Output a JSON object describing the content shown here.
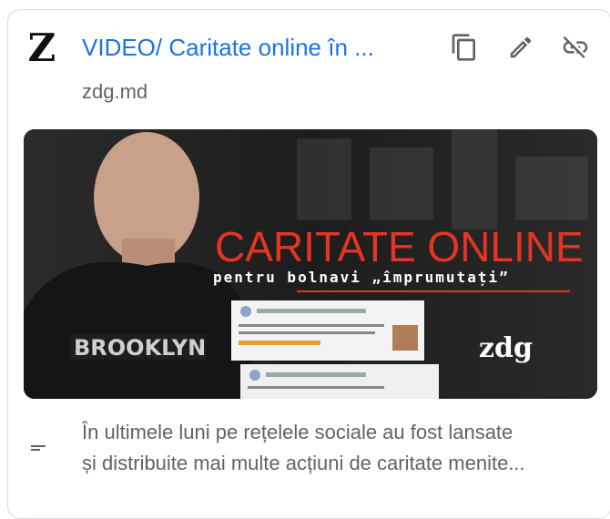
{
  "link_card": {
    "favicon_letter": "Z",
    "title": "VIDEO/ Caritate online în ...",
    "domain": "zdg.md",
    "description_lines": [
      "În ultimele luni pe rețelele sociale au fost lansate",
      "și distribuite mai multe acțiuni de caritate menite..."
    ],
    "actions": [
      "copy-icon",
      "edit-icon",
      "unlink-icon"
    ]
  },
  "thumbnail": {
    "headline": "CARITATE ONLINE",
    "subheadline": "pentru bolnavi „împrumutați”",
    "brand": "zdg",
    "hoodie_text": "BROOKLYN",
    "headline_color": "#e53422"
  },
  "colors": {
    "title": "#1a73e8",
    "secondary_text": "#5f6368",
    "icon": "#5f6368"
  }
}
